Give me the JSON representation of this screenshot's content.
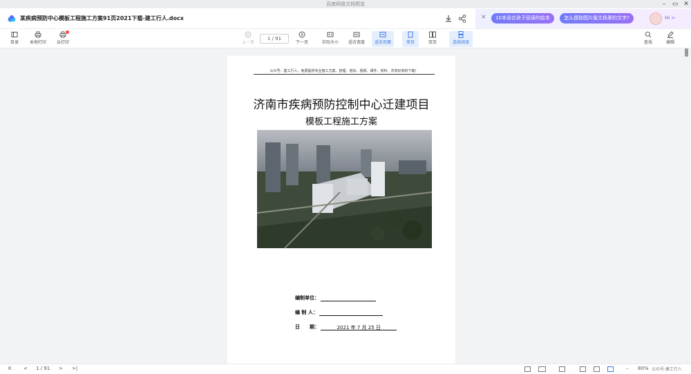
{
  "window": {
    "app_title": "百度网盘文档预览",
    "minimize": "–",
    "restore": "▭",
    "close": "✕"
  },
  "doc": {
    "title": "某疾病预防中心模板工程施工方案91页2021下载-建工行人.docx"
  },
  "ai": {
    "close": "×",
    "chip1": "10本适合孩子阅读的绘本",
    "chip2": "怎么提取图片版文档里的文字?",
    "hi": "Hi >"
  },
  "toolbar": {
    "toc": "目录",
    "local_print": "本地打印",
    "cloud_print": "云打印",
    "prev_page": "上一页",
    "page_indicator": "1 / 91",
    "next_page": "下一页",
    "actual_size": "实际大小",
    "fit_width": "适合宽度",
    "fit_page": "适合页面",
    "single_page": "单页",
    "double_page": "双页",
    "continuous": "连续阅读",
    "find": "查找",
    "edit": "编辑"
  },
  "page": {
    "header_note": "公众号：建工行人，免费提供专业施工方案、管理、培训、视频、课件、资料、共享好资料下载！",
    "title_line1": "济南市疾病预防控制中心迁建项目",
    "title_line2": "模板工程施工方案",
    "field_unit_label": "编制单位：",
    "field_person_label": "编 制 人：",
    "field_date_label": "日　　期：",
    "field_date_value": "2021 年 7 月 25 日"
  },
  "status": {
    "first": "K",
    "prev": "<",
    "page": "1 / 91",
    "next": ">",
    "last": ">|",
    "zoom_out": "–",
    "zoom": "80%",
    "zoom_in": "+",
    "watermark": "公众号·建工行人"
  },
  "colors": {
    "accent": "#3b7ae8",
    "ai_chip": "#7a73f4",
    "red_dot": "#ff4444"
  }
}
